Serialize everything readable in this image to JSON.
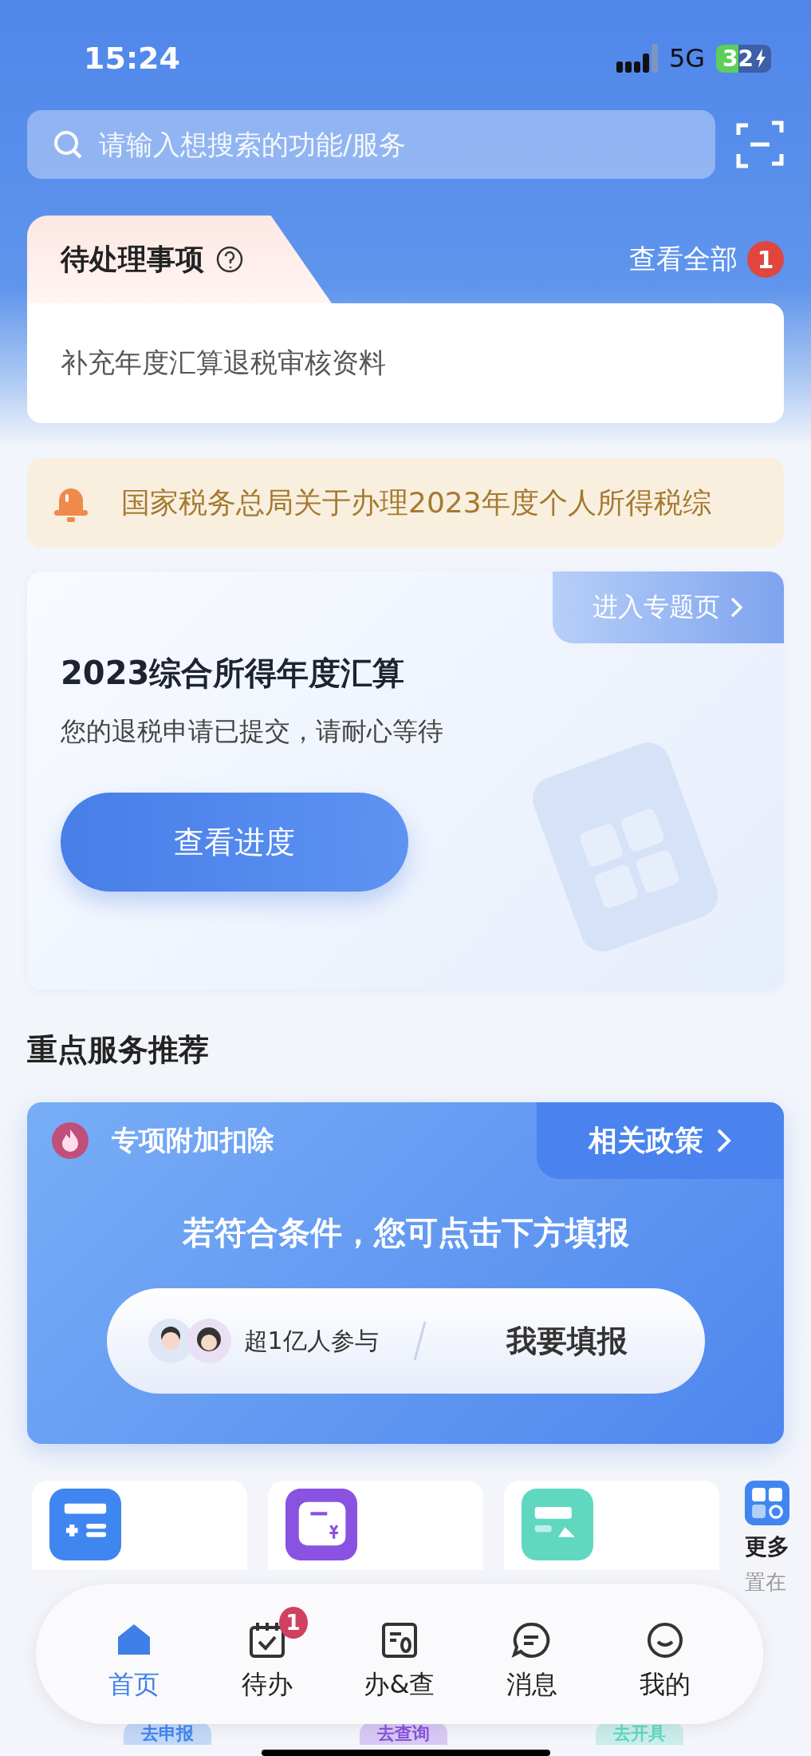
{
  "status_bar": {
    "time": "15:24",
    "network": "5G",
    "battery": "32"
  },
  "search": {
    "placeholder": "请输入想搜索的功能/服务"
  },
  "pending": {
    "title": "待处理事项",
    "view_all": "查看全部",
    "badge": "1",
    "items": [
      "补充年度汇算退税审核资料"
    ]
  },
  "notice": {
    "text": "国家税务总局关于办理2023年度个人所得税综"
  },
  "annual": {
    "link": "进入专题页",
    "title": "2023综合所得年度汇算",
    "subtitle": "您的退税申请已提交，请耐心等待",
    "button": "查看进度"
  },
  "section_title": "重点服务推荐",
  "special": {
    "title": "专项附加扣除",
    "link": "相关政策",
    "prompt": "若符合条件，您可点击下方填报",
    "participants": "超1亿人参与",
    "action": "我要填报"
  },
  "services": [
    {
      "kind": "service",
      "color": "#3f86f0",
      "action": "去申报"
    },
    {
      "kind": "service",
      "color": "#8a52e0",
      "action": "去查询"
    },
    {
      "kind": "service",
      "color": "#5fd8bf",
      "action": "去开具"
    },
    {
      "kind": "more",
      "color": "#3f86f0",
      "title": "更多",
      "note": "置在"
    }
  ],
  "tabs": [
    {
      "label": "首页",
      "selected": true
    },
    {
      "label": "待办",
      "selected": false,
      "badge": "1"
    },
    {
      "label": "办&查",
      "selected": false
    },
    {
      "label": "消息",
      "selected": false
    },
    {
      "label": "我的",
      "selected": false
    }
  ]
}
